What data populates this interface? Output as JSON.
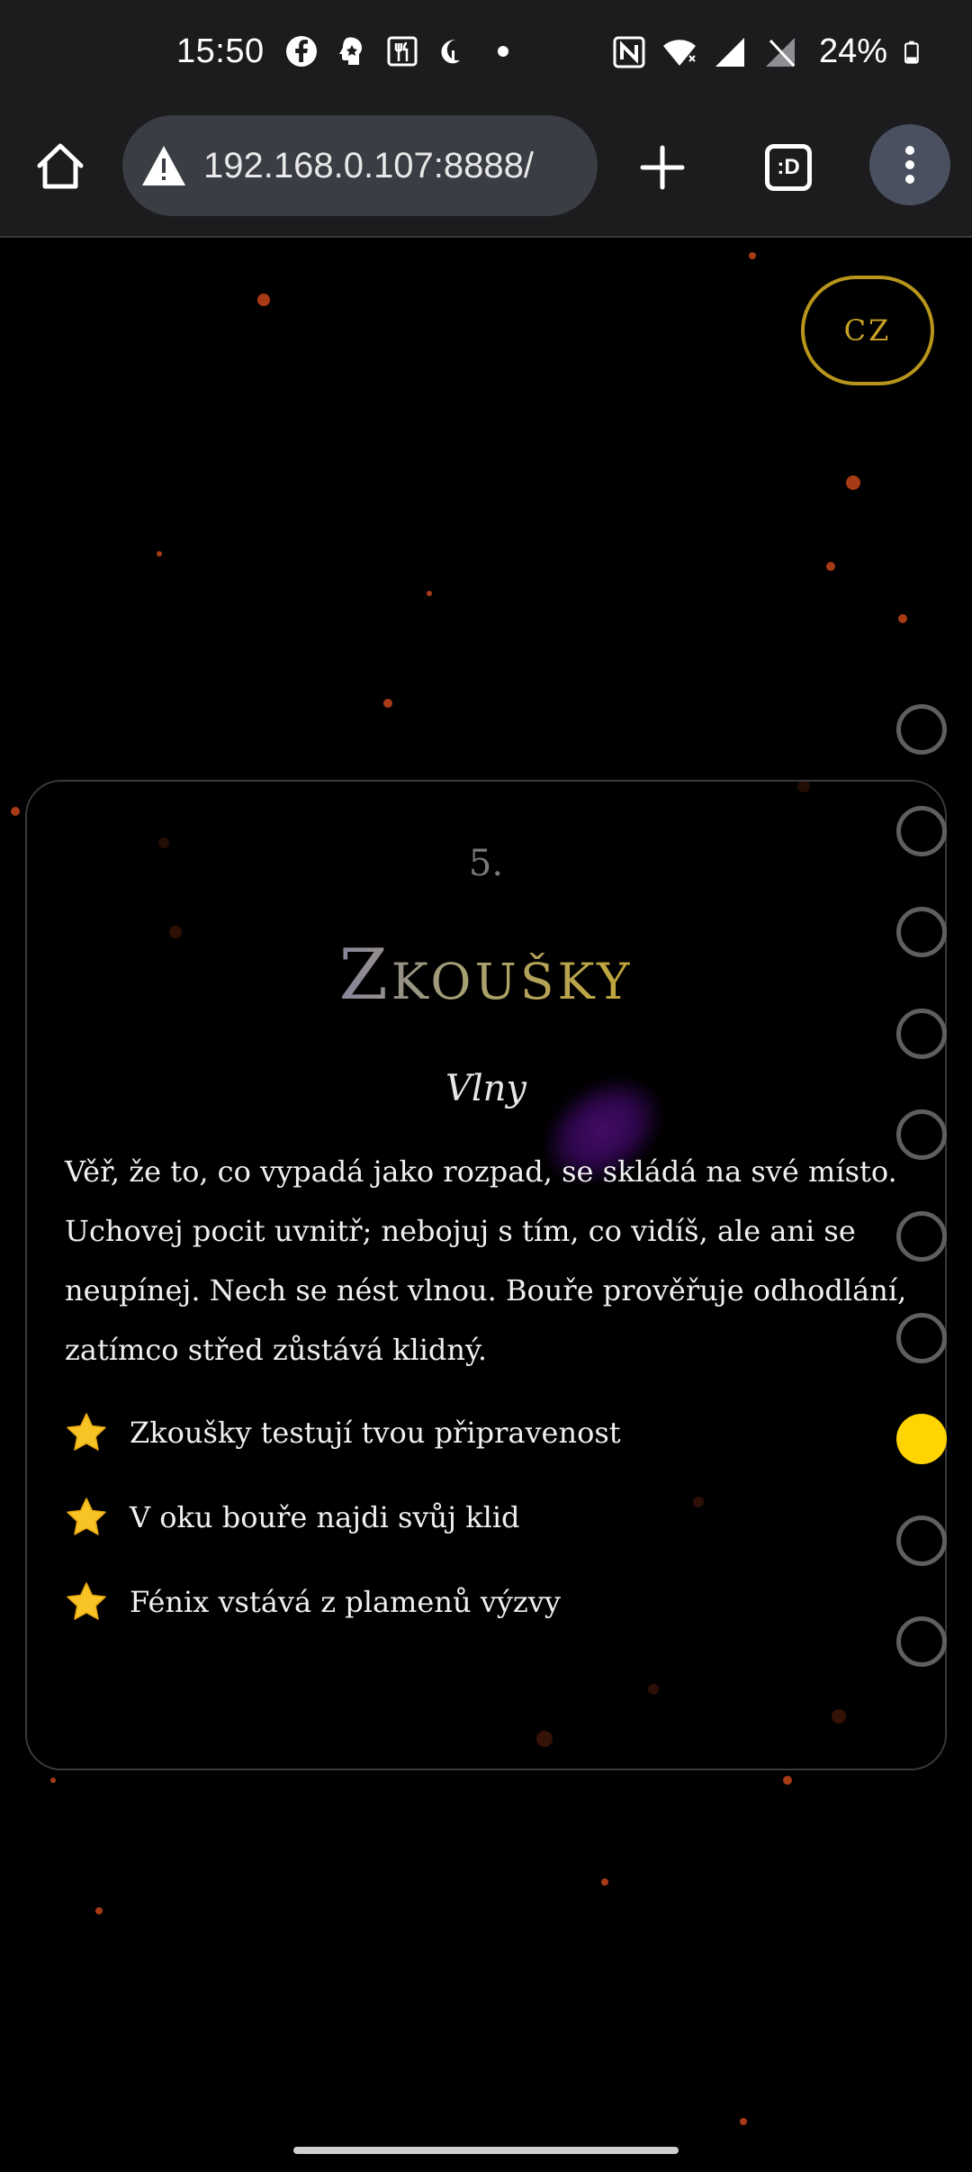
{
  "status_bar": {
    "time": "15:50",
    "left_icons": [
      "facebook-icon",
      "assistant-icon",
      "restaurant-icon",
      "sleep-icon",
      "dot-icon"
    ],
    "right_icons": [
      "nfc-icon",
      "wifi-icon",
      "signal-icon",
      "no-signal-icon",
      "battery-icon"
    ],
    "battery": "24%"
  },
  "browser": {
    "url": "192.168.0.107:8888/",
    "tab_label": ":D",
    "icons": [
      "home-icon",
      "warning-icon",
      "plus-icon",
      "tabs-icon",
      "menu-icon"
    ]
  },
  "page": {
    "language_button": "CZ",
    "card": {
      "number": "5.",
      "title": "Zkoušky",
      "subtitle": "Vlny",
      "body_lines": [
        "Věř, že to, co vypadá jako rozpad, se skládá na své místo.",
        "Uchovej pocit uvnitř; nebojuj s tím, co vidíš, ale ani se",
        "neupínej. Nech se nést vlnou. Bouře prověřuje odhodlání,",
        "zatímco střed zůstává klidný."
      ],
      "bullets": [
        "Zkoušky testují tvou připravenost",
        "V oku bouře najdi svůj klid",
        "Fénix vstává z plamenů výzvy"
      ]
    },
    "navigation": {
      "total": 10,
      "active_index": 7
    },
    "colors": {
      "accent_gold": "#c9a326",
      "active_dot": "#ffd400",
      "title_gradient_start": "#5540d8",
      "title_gradient_end": "#d0a418",
      "spark": "#c4451a"
    }
  }
}
